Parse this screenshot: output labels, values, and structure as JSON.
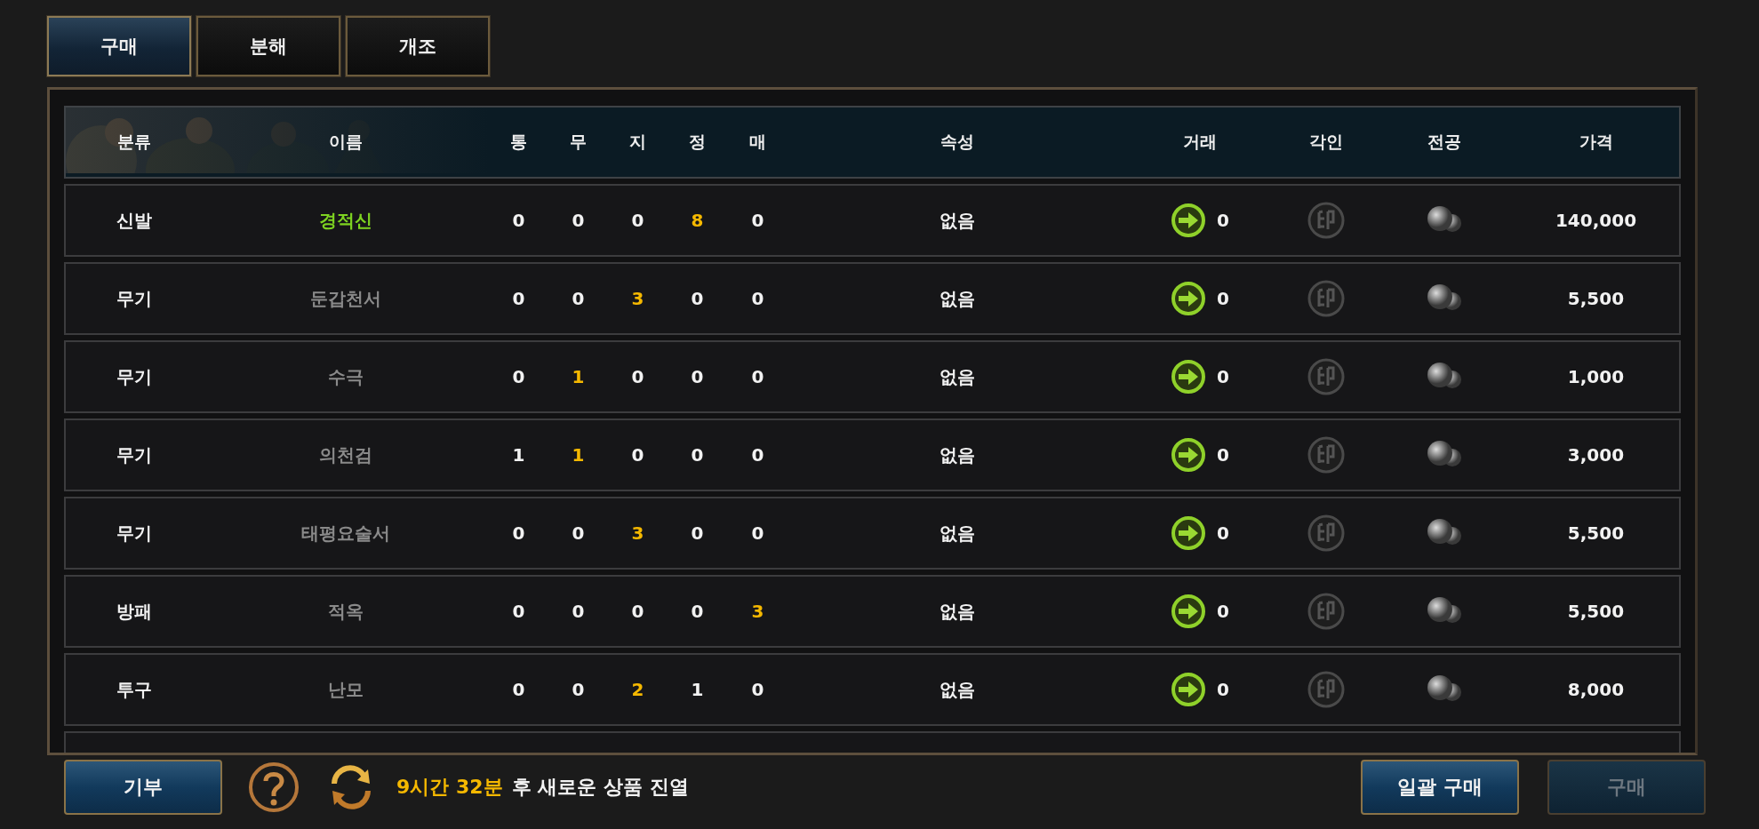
{
  "tabs": [
    {
      "label": "구매",
      "selected": true
    },
    {
      "label": "분해",
      "selected": false
    },
    {
      "label": "개조",
      "selected": false
    }
  ],
  "table": {
    "columns": [
      "분류",
      "이름",
      "통",
      "무",
      "지",
      "정",
      "매",
      "속성",
      "거래",
      "각인",
      "전공",
      "가격"
    ],
    "rows": [
      {
        "category": "신발",
        "name": "경적신",
        "color": "#7ed321",
        "stats": [
          {
            "value": "0",
            "highlighted": false
          },
          {
            "value": "0",
            "highlighted": false
          },
          {
            "value": "0",
            "highlighted": false
          },
          {
            "value": "8",
            "highlighted": true
          },
          {
            "value": "0",
            "highlighted": false
          }
        ],
        "attribute": "없음",
        "trade": "0",
        "price": "140,000"
      },
      {
        "category": "무기",
        "name": "둔갑천서",
        "color": "#8a8a8a",
        "stats": [
          {
            "value": "0",
            "highlighted": false
          },
          {
            "value": "0",
            "highlighted": false
          },
          {
            "value": "3",
            "highlighted": true
          },
          {
            "value": "0",
            "highlighted": false
          },
          {
            "value": "0",
            "highlighted": false
          }
        ],
        "attribute": "없음",
        "trade": "0",
        "price": "5,500"
      },
      {
        "category": "무기",
        "name": "수극",
        "color": "#8a8a8a",
        "stats": [
          {
            "value": "0",
            "highlighted": false
          },
          {
            "value": "1",
            "highlighted": true
          },
          {
            "value": "0",
            "highlighted": false
          },
          {
            "value": "0",
            "highlighted": false
          },
          {
            "value": "0",
            "highlighted": false
          }
        ],
        "attribute": "없음",
        "trade": "0",
        "price": "1,000"
      },
      {
        "category": "무기",
        "name": "의천검",
        "color": "#8a8a8a",
        "stats": [
          {
            "value": "1",
            "highlighted": false
          },
          {
            "value": "1",
            "highlighted": true
          },
          {
            "value": "0",
            "highlighted": false
          },
          {
            "value": "0",
            "highlighted": false
          },
          {
            "value": "0",
            "highlighted": false
          }
        ],
        "attribute": "없음",
        "trade": "0",
        "price": "3,000"
      },
      {
        "category": "무기",
        "name": "태평요술서",
        "color": "#8a8a8a",
        "stats": [
          {
            "value": "0",
            "highlighted": false
          },
          {
            "value": "0",
            "highlighted": false
          },
          {
            "value": "3",
            "highlighted": true
          },
          {
            "value": "0",
            "highlighted": false
          },
          {
            "value": "0",
            "highlighted": false
          }
        ],
        "attribute": "없음",
        "trade": "0",
        "price": "5,500"
      },
      {
        "category": "방패",
        "name": "적옥",
        "color": "#8a8a8a",
        "stats": [
          {
            "value": "0",
            "highlighted": false
          },
          {
            "value": "0",
            "highlighted": false
          },
          {
            "value": "0",
            "highlighted": false
          },
          {
            "value": "0",
            "highlighted": false
          },
          {
            "value": "3",
            "highlighted": true
          }
        ],
        "attribute": "없음",
        "trade": "0",
        "price": "5,500"
      },
      {
        "category": "투구",
        "name": "난모",
        "color": "#8a8a8a",
        "stats": [
          {
            "value": "0",
            "highlighted": false
          },
          {
            "value": "0",
            "highlighted": false
          },
          {
            "value": "2",
            "highlighted": true
          },
          {
            "value": "1",
            "highlighted": false
          },
          {
            "value": "0",
            "highlighted": false
          }
        ],
        "attribute": "없음",
        "trade": "0",
        "price": "8,000"
      }
    ]
  },
  "footer": {
    "donate_button": {
      "label": "기부"
    },
    "timer": "9시간 32분",
    "message": "후 새로운 상품 진열",
    "buttons": [
      {
        "label": "일괄 구매",
        "disabled": false
      },
      {
        "label": "구매",
        "disabled": true
      }
    ]
  }
}
